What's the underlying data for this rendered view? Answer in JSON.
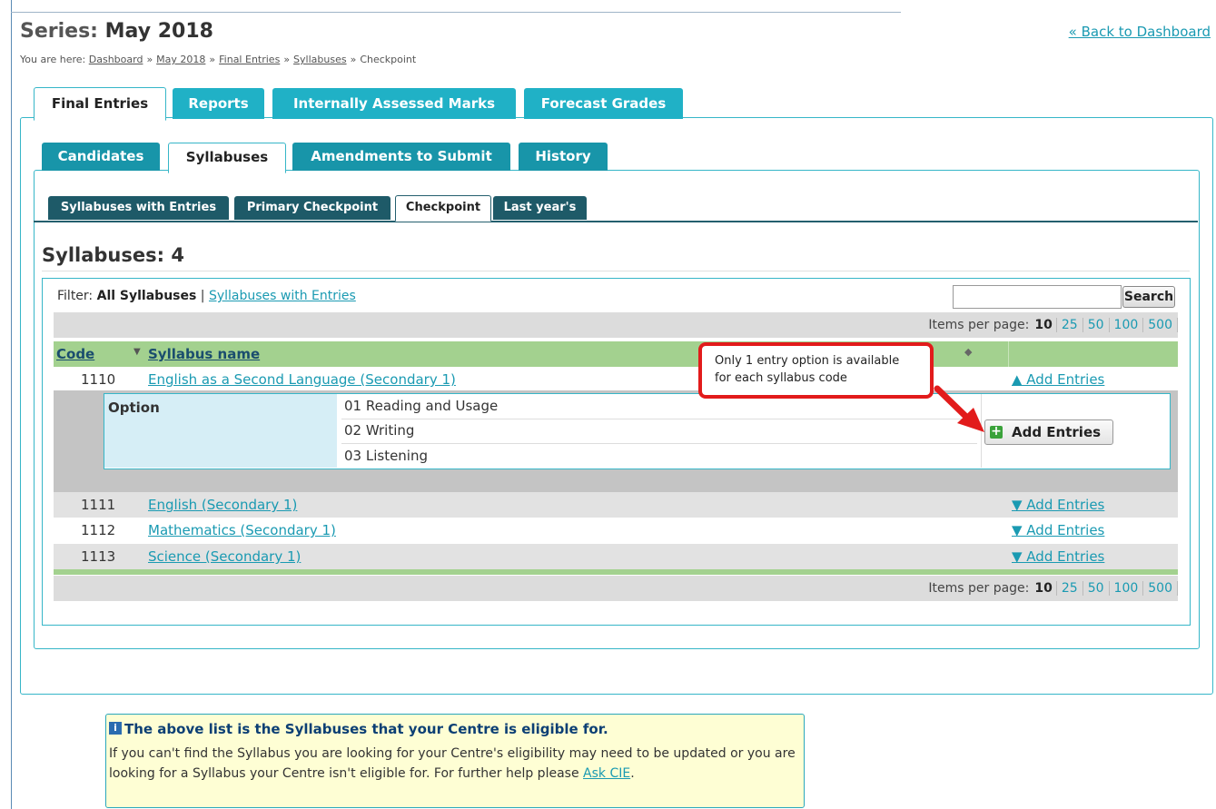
{
  "header": {
    "series_prefix": "Series:",
    "series_name": "May 2018",
    "back_link": "« Back to Dashboard"
  },
  "breadcrumb": {
    "prefix": "You are here:",
    "items": [
      "Dashboard",
      "May 2018",
      "Final Entries",
      "Syllabuses"
    ],
    "current": "Checkpoint",
    "separator": "»"
  },
  "main_tabs": [
    "Final Entries",
    "Reports",
    "Internally Assessed Marks",
    "Forecast Grades"
  ],
  "sub_tabs": [
    "Candidates",
    "Syllabuses",
    "Amendments to Submit",
    "History"
  ],
  "sub_sub_tabs": [
    "Syllabuses with Entries",
    "Primary Checkpoint",
    "Checkpoint",
    "Last year's"
  ],
  "section_title": "Syllabuses: 4",
  "filter": {
    "prefix": "Filter:",
    "active": "All Syllabuses",
    "separator": "|",
    "link": "Syllabuses with Entries"
  },
  "search": {
    "button": "Search",
    "value": ""
  },
  "pager": {
    "label": "Items per page:",
    "current": "10",
    "options": [
      "25",
      "50",
      "100",
      "500"
    ]
  },
  "table": {
    "headers": {
      "code": "Code",
      "name": "Syllabus name"
    },
    "sort_down_icon": "▼",
    "sort_both_icon": "◆",
    "rows": [
      {
        "code": "1110",
        "name": "English as a Second Language (Secondary 1)",
        "action": "▲ Add Entries"
      },
      {
        "code": "1111",
        "name": "English (Secondary 1)",
        "action": "▼ Add Entries"
      },
      {
        "code": "1112",
        "name": "Mathematics (Secondary 1)",
        "action": "▼ Add Entries"
      },
      {
        "code": "1113",
        "name": "Science (Secondary 1)",
        "action": "▼ Add Entries"
      }
    ],
    "option_label": "Option",
    "options": [
      "01 Reading and Usage",
      "02 Writing",
      "03 Listening"
    ],
    "add_button": "Add Entries"
  },
  "callout": "Only 1 entry option is available for each syllabus code",
  "info": {
    "title": "The above list is the Syllabuses that your Centre is eligible for.",
    "body": "If you can't find the Syllabus you are looking for your Centre's eligibility may need to be updated or you are looking for a Syllabus your Centre isn't eligible for. For further help please",
    "link": "Ask CIE",
    "end": "."
  },
  "colors": {
    "tab_primary": "#20b1c6",
    "tab_secondary": "#1895a9",
    "tab_tertiary": "#1e5a68",
    "header_green": "#a3d18f",
    "callout_red": "#e21b1b",
    "info_bg": "#fefed4"
  }
}
